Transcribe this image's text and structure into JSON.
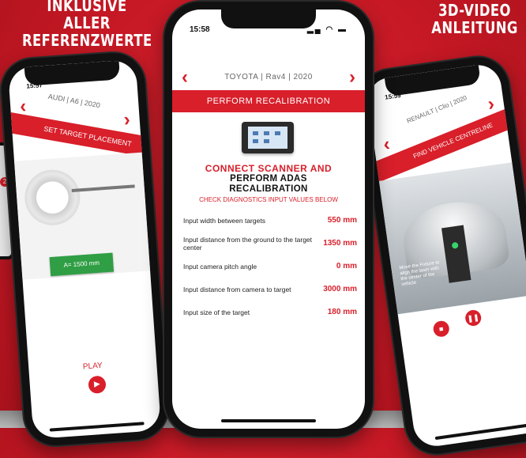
{
  "promo": {
    "left_headline_1": "INKLUSIVE ALLER",
    "left_headline_2": "REFERENZWERTE",
    "right_headline_1": "3D-VIDEO",
    "right_headline_2": "ANLEITUNG"
  },
  "colors": {
    "brand_red": "#d81f2a",
    "target_green": "#2f9e44"
  },
  "center_phone": {
    "time": "15:58",
    "vehicle": "TOYOTA | Rav4 | 2020",
    "banner": "PERFORM RECALIBRATION",
    "heading_red": "CONNECT SCANNER AND",
    "heading_black_1": "PERFORM ADAS",
    "heading_black_2": "RECALIBRATION",
    "subheading": "CHECK DIAGNOSTICS INPUT VALUES BELOW",
    "rows": [
      {
        "label": "Input width between targets",
        "value": "550 mm"
      },
      {
        "label": "Input distance from the ground to the target center",
        "value": "1350 mm"
      },
      {
        "label": "Input camera pitch angle",
        "value": "0 mm"
      },
      {
        "label": "Input distance from camera to target",
        "value": "3000 mm"
      },
      {
        "label": "Input size of the target",
        "value": "180 mm"
      }
    ]
  },
  "left_phone": {
    "time": "15:57",
    "vehicle": "AUDI | A6 | 2020",
    "banner": "SET TARGET PLACEMENT",
    "target_label": "A= 1500 mm",
    "play_label": "PLAY"
  },
  "right_phone": {
    "time": "15:59",
    "vehicle": "RENAULT | Clio | 2020",
    "banner": "FIND VEHICLE CENTRELINE",
    "note": "Move the Fixture to align the laser with the center of the vehicle"
  },
  "edge_phone": {
    "badge": "2"
  }
}
